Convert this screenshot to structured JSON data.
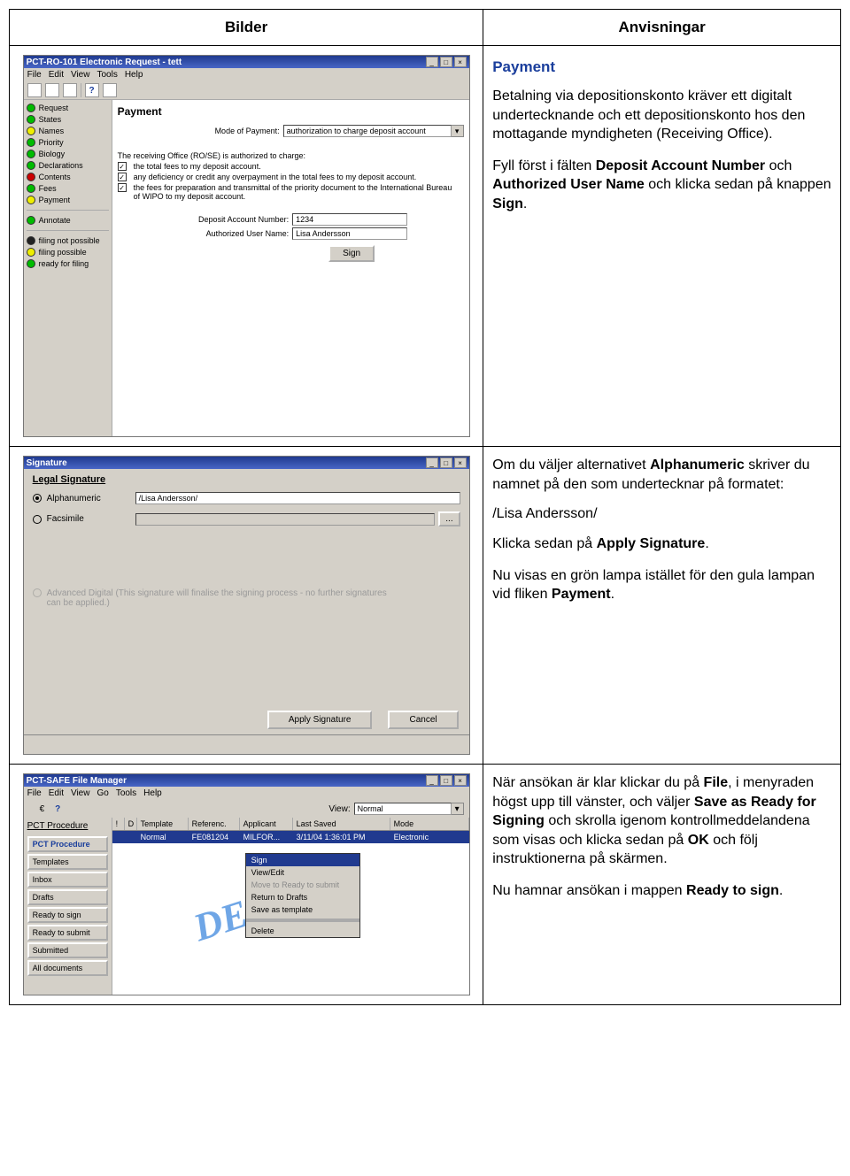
{
  "headers": {
    "left": "Bilder",
    "right": "Anvisningar"
  },
  "right1": {
    "title": "Payment",
    "p1a": "Betalning via depositionskonto kräver ett digitalt undertecknande och ett depositionskonto hos den mottagande myndigheten (Receiving Office).",
    "p2_pre": "Fyll först i fälten ",
    "p2_b1": "Deposit Account Number",
    "p2_mid": " och ",
    "p2_b2": "Authorized User Name",
    "p2_mid2": " och klicka sedan på knappen ",
    "p2_b3": "Sign",
    "p2_end": "."
  },
  "right2": {
    "p1_pre": "Om du väljer alternativet ",
    "p1_b1": "Alphanumeric",
    "p1_post": " skriver du namnet på den som undertecknar på formatet:",
    "example": "/Lisa Andersson/",
    "p2_pre": "Klicka sedan på ",
    "p2_b1": "Apply Signature",
    "p2_end": ".",
    "p3_pre": "Nu visas en grön lampa istället för den gula lampan vid fliken ",
    "p3_b1": "Payment",
    "p3_end": "."
  },
  "right3": {
    "p1_pre": "När ansökan är klar klickar du på ",
    "p1_b1": "File",
    "p1_mid1": ", i menyraden högst upp till vänster, och väljer ",
    "p1_b2": "Save as Ready for Signing",
    "p1_mid2": " och skrolla igenom kontrollmeddelandena som visas och klicka sedan på ",
    "p1_b3": "OK",
    "p1_mid3": " och följ instruktionerna på skärmen.",
    "p2_pre": "Nu hamnar ansökan i mappen ",
    "p2_b1": "Ready to sign",
    "p2_end": "."
  },
  "win1": {
    "title": "PCT-RO-101 Electronic Request - tett",
    "menu": [
      "File",
      "Edit",
      "View",
      "Tools",
      "Help"
    ],
    "section_title": "Payment",
    "mode_label": "Mode of Payment:",
    "mode_value": "authorization to charge deposit account",
    "auth_note": "The receiving Office (RO/SE) is authorized to charge:",
    "cb1": "the total fees to my deposit account.",
    "cb2": "any deficiency or credit any overpayment in the total fees to my deposit account.",
    "cb3": "the fees for preparation and transmittal of the priority document to the International Bureau of WIPO to my deposit account.",
    "dan_label": "Deposit Account Number:",
    "dan_value": "1234",
    "aun_label": "Authorized User Name:",
    "aun_value": "Lisa Andersson",
    "sign_btn": "Sign",
    "side": [
      "Request",
      "States",
      "Names",
      "Priority",
      "Biology",
      "Declarations",
      "Contents",
      "Fees",
      "Payment",
      "Annotate"
    ],
    "legend": [
      "filing not possible",
      "filing possible",
      "ready for filing"
    ]
  },
  "win2": {
    "title": "Signature",
    "group": "Legal Signature",
    "alpha": "Alphanumeric",
    "alpha_value": "/Lisa Andersson/",
    "fax": "Facsimile",
    "ellipsis": "...",
    "adv_label": "Advanced Digital",
    "adv_note": "(This signature will finalise the signing process - no further signatures can be applied.)",
    "apply": "Apply Signature",
    "cancel": "Cancel"
  },
  "win3": {
    "title": "PCT-SAFE File Manager",
    "menu": [
      "File",
      "Edit",
      "View",
      "Go",
      "Tools",
      "Help"
    ],
    "view_label": "View:",
    "view_value": "Normal",
    "proc_link": "PCT Procedure",
    "side_title": "PCT Procedure",
    "side": [
      "Templates",
      "Inbox",
      "Drafts",
      "Ready to sign",
      "Ready to submit",
      "Submitted",
      "All documents"
    ],
    "cols": [
      "!",
      "D",
      "Template",
      "Referenc.",
      "Applicant",
      "Last Saved",
      "Mode"
    ],
    "row": [
      "",
      "",
      "Normal",
      "FE081204",
      "MILFOR...",
      "3/11/04 1:36:01 PM",
      "Electronic"
    ],
    "ctx": [
      "Sign",
      "View/Edit",
      "Move to Ready to submit",
      "Return to Drafts",
      "Save as template",
      "Delete"
    ],
    "demo": "DEMO"
  }
}
